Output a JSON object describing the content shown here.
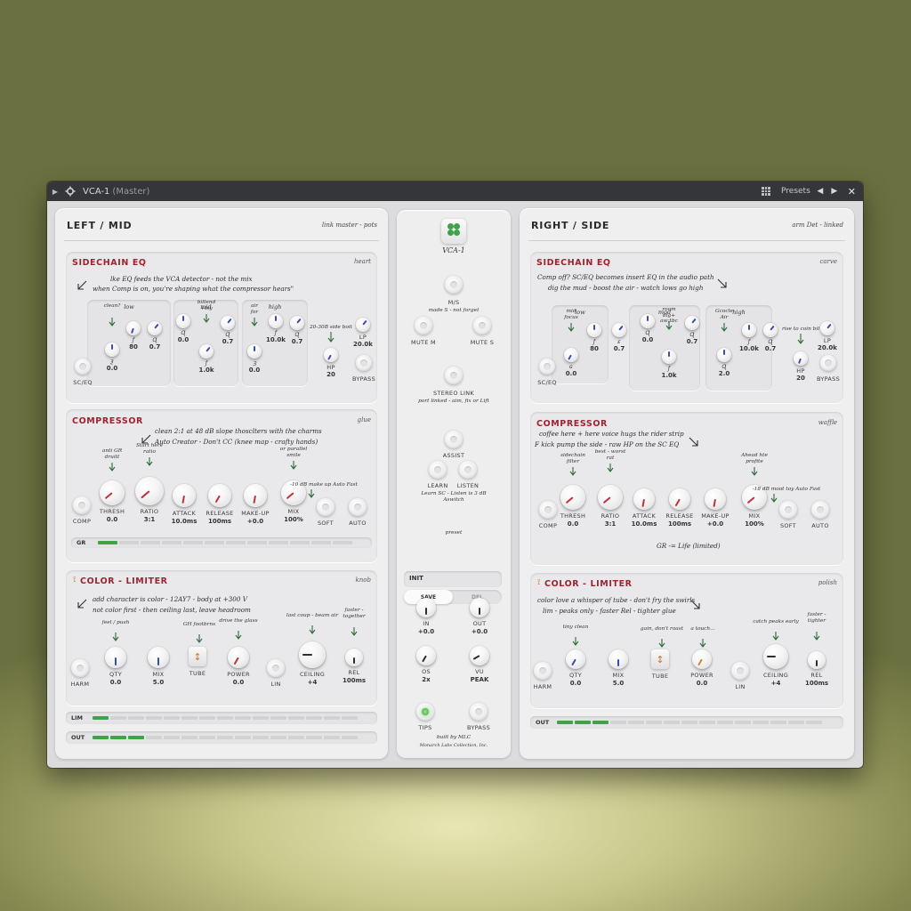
{
  "titlebar": {
    "title": "VCA-1",
    "subtitle": "(Master)",
    "presets_label": "Presets",
    "close": "✕"
  },
  "left": {
    "title": "LEFT / MID",
    "note": "link master - pots",
    "sidechain": {
      "title": "SIDECHAIN EQ",
      "tag": "heart",
      "hand1": "lke EQ feeds the VCA detector - not the mix",
      "hand2": "when Comp is on, you're shaping what the compressor hears\"",
      "bands": {
        "low": "low",
        "mid": "mid",
        "high": "high"
      },
      "notes": {
        "clean": "clean?",
        "mid": "biltend\n+tsy",
        "air": "air\nfor",
        "hp": "20-30B side boit"
      },
      "controls": [
        {
          "id": "sceq",
          "label": "SC/EQ",
          "value": ""
        },
        {
          "id": "low_g",
          "label": "",
          "value": "0.0",
          "sym": "ƺ"
        },
        {
          "id": "low_f",
          "label": "",
          "value": "80",
          "sym": "ƒ"
        },
        {
          "id": "low_q",
          "label": "",
          "value": "0.7",
          "sym": "Ɋ"
        },
        {
          "id": "mid_g",
          "label": "",
          "value": "0.0",
          "sym": "Ɋ"
        },
        {
          "id": "mid_f",
          "label": "",
          "value": "1.0k",
          "sym": "ƒ"
        },
        {
          "id": "mid_q",
          "label": "",
          "value": "0.7",
          "sym": "Ɋ"
        },
        {
          "id": "high_g",
          "label": "",
          "value": "0.0",
          "sym": "Ɜ"
        },
        {
          "id": "high_f",
          "label": "",
          "value": "10.0k",
          "sym": "ƒ"
        },
        {
          "id": "high_q",
          "label": "",
          "value": "0.7",
          "sym": "Ɋ"
        },
        {
          "id": "hp",
          "label": "HP",
          "value": "20"
        },
        {
          "id": "lp",
          "label": "LP",
          "value": "20.0k"
        },
        {
          "id": "bypass",
          "label": "BYPASS",
          "value": ""
        }
      ]
    },
    "compressor": {
      "title": "COMPRESSOR",
      "tag": "glue",
      "hand1": "clean 2:1 at 48 dB slope thosclters with the charms",
      "hand2": "Auto Creator - Don't CC (knee map - crafty hands)",
      "notes": {
        "thresh": "anti GR\ndruitt",
        "ratio": "Start here\nratio",
        "mix": "or parallel\nsmile",
        "soft": "-10 dB make up Auto Fast"
      },
      "controls": [
        {
          "id": "comp",
          "label": "COMP",
          "value": ""
        },
        {
          "id": "thresh",
          "label": "THRESH",
          "value": "0.0"
        },
        {
          "id": "ratio",
          "label": "RATIO",
          "value": "3:1"
        },
        {
          "id": "attack",
          "label": "ATTACK",
          "value": "10.0ms"
        },
        {
          "id": "release",
          "label": "RELEASE",
          "value": "100ms"
        },
        {
          "id": "makeup",
          "label": "MAKE-UP",
          "value": "+0.0"
        },
        {
          "id": "mix",
          "label": "MIX",
          "value": "100%"
        },
        {
          "id": "soft",
          "label": "SOFT",
          "value": ""
        },
        {
          "id": "auto",
          "label": "AUTO",
          "value": ""
        }
      ],
      "gr_label": "GR",
      "gr_level": 0.08
    },
    "color": {
      "title": "COLOR - LIMITER",
      "tag": "knob",
      "hand1": "add character is color - 12AY7 - body at +300 V",
      "hand2": "not color first - then ceiling last, leave headroom",
      "notes": {
        "qty": "feel / push",
        "tube": "GH footbrns",
        "power": "drive the glass",
        "ceiling": "last coup - beam air",
        "rel": "faster -\ntogether"
      },
      "controls": [
        {
          "id": "harm",
          "label": "HARM",
          "value": ""
        },
        {
          "id": "qty",
          "label": "QTY",
          "value": "0.0"
        },
        {
          "id": "mix",
          "label": "MIX",
          "value": "5.0"
        },
        {
          "id": "tube",
          "label": "TUBE",
          "value": ""
        },
        {
          "id": "power",
          "label": "POWER",
          "value": "0.0"
        },
        {
          "id": "lin",
          "label": "LIN",
          "value": ""
        },
        {
          "id": "ceiling",
          "label": "CEILING",
          "value": "+4"
        },
        {
          "id": "rel",
          "label": "REL",
          "value": "100ms"
        }
      ]
    },
    "meters": [
      {
        "name": "LIM",
        "level": 0.08
      },
      {
        "name": "OUT",
        "level": 0.2
      }
    ]
  },
  "right": {
    "title": "RIGHT / SIDE",
    "note": "arm Det - linked",
    "sidechain": {
      "title": "SIDECHAIN EQ",
      "tag": "carve",
      "hand1": "Comp off? SC/EQ becomes insert EQ in the audio path",
      "hand2": "dig the mud - boost the air - watch lows go high",
      "bands": {
        "low": "low",
        "mid": "mod",
        "high": "high"
      },
      "notes": {
        "clean": "mid\nfocus",
        "mid": "room\ndig+\naw;tbc",
        "air": "Gcocle\nAir",
        "hp": "rise to coin bil"
      },
      "controls": [
        {
          "id": "sceq",
          "label": "SC/EQ",
          "value": ""
        },
        {
          "id": "low_g",
          "label": "",
          "value": "0.0",
          "sym": "ɢ"
        },
        {
          "id": "low_f",
          "label": "",
          "value": "80",
          "sym": "ƒ"
        },
        {
          "id": "low_q",
          "label": "",
          "value": "0.7",
          "sym": "ɛ"
        },
        {
          "id": "mid_g",
          "label": "",
          "value": "0.0",
          "sym": "Ɋ"
        },
        {
          "id": "mid_f",
          "label": "",
          "value": "1.0k",
          "sym": "ƒ"
        },
        {
          "id": "mid_q",
          "label": "",
          "value": "0.7",
          "sym": "Ɋ"
        },
        {
          "id": "high_g",
          "label": "",
          "value": "2.0",
          "sym": "Ɋ"
        },
        {
          "id": "high_f",
          "label": "",
          "value": "10.0k",
          "sym": "ƒ"
        },
        {
          "id": "high_q",
          "label": "",
          "value": "0.7",
          "sym": "Ɋ"
        },
        {
          "id": "hp",
          "label": "HP",
          "value": "20"
        },
        {
          "id": "lp",
          "label": "LP",
          "value": "20.0k"
        },
        {
          "id": "bypass",
          "label": "BYPASS",
          "value": ""
        }
      ]
    },
    "compressor": {
      "title": "COMPRESSOR",
      "tag": "waffle",
      "hand1": "coffee here + here voice hugs the rider strip",
      "hand2": "F kick pump the side - raw HP on the SC EQ",
      "notes": {
        "thresh": "sidechain\nfilter",
        "ratio": "best - worst\nrat",
        "mix": "Ahead hte\nprofite",
        "soft": "-18 dB moot toy Auto Fast"
      },
      "controls": [
        {
          "id": "comp",
          "label": "COMP",
          "value": ""
        },
        {
          "id": "thresh",
          "label": "THRESH",
          "value": "0.0"
        },
        {
          "id": "ratio",
          "label": "RATIO",
          "value": "3:1"
        },
        {
          "id": "attack",
          "label": "ATTACK",
          "value": "10.0ms"
        },
        {
          "id": "release",
          "label": "RELEASE",
          "value": "100ms"
        },
        {
          "id": "makeup",
          "label": "MAKE-UP",
          "value": "+0.0"
        },
        {
          "id": "mix",
          "label": "MIX",
          "value": "100%"
        },
        {
          "id": "soft",
          "label": "SOFT",
          "value": ""
        },
        {
          "id": "auto",
          "label": "AUTO",
          "value": ""
        }
      ],
      "gr_text": "GR -= Life (limited)"
    },
    "color": {
      "title": "COLOR - LIMITER",
      "tag": "polish",
      "hand1": "color love a whisper of tube - don't fry the swirls",
      "hand2": "lim - peaks only - faster Rel - tighter glue",
      "notes": {
        "qty": "tiny clean",
        "tube": "gain, don't roast",
        "power": "a touch...",
        "ceiling": "catch peaks early",
        "rel": "faster -\ntighter"
      },
      "controls": [
        {
          "id": "harm",
          "label": "HARM",
          "value": ""
        },
        {
          "id": "qty",
          "label": "QTY",
          "value": "0.0"
        },
        {
          "id": "mix",
          "label": "MIX",
          "value": "5.0"
        },
        {
          "id": "tube",
          "label": "TUBE",
          "value": ""
        },
        {
          "id": "power",
          "label": "POWER",
          "value": "0.0"
        },
        {
          "id": "lin",
          "label": "LIN",
          "value": ""
        },
        {
          "id": "ceiling",
          "label": "CEILING",
          "value": "+4"
        },
        {
          "id": "rel",
          "label": "REL",
          "value": "100ms"
        }
      ]
    },
    "meters": [
      {
        "name": "OUT",
        "level": 0.2
      }
    ]
  },
  "center": {
    "logo_name": "VCA-1",
    "ms_label": "M/S",
    "ms_note": "made S - not forget",
    "mute_m": "MUTE M",
    "mute_s": "MUTE S",
    "stereo_link": "STEREO LINK",
    "link_note": "port linked - aim, fix or Lift",
    "assist": "ASSIST",
    "learn": "LEARN",
    "listen": "LISTEN",
    "assist_note": "Learn SC - Listen is 3 dB\nAswitch",
    "preset_label": "preset",
    "preset_value": "INIT",
    "save": "SAVE",
    "del": "DEL",
    "in_label": "IN",
    "in_value": "+0.0",
    "out_label": "OUT",
    "out_value": "+0.0",
    "os_label": "OS",
    "os_value": "2x",
    "vu_label": "VU",
    "vu_value": "PEAK",
    "tips": "TIPS",
    "bypass": "BYPASS",
    "built_by": "built by MLC",
    "company": "Monarch Labs Collection, Inc."
  },
  "colors": {
    "accent_red": "#9c2330",
    "led_green": "#3fa34a",
    "pointer_blue": "#3b4bb0",
    "pointer_red": "#c0303a",
    "pointer_orange": "#d3822f"
  }
}
